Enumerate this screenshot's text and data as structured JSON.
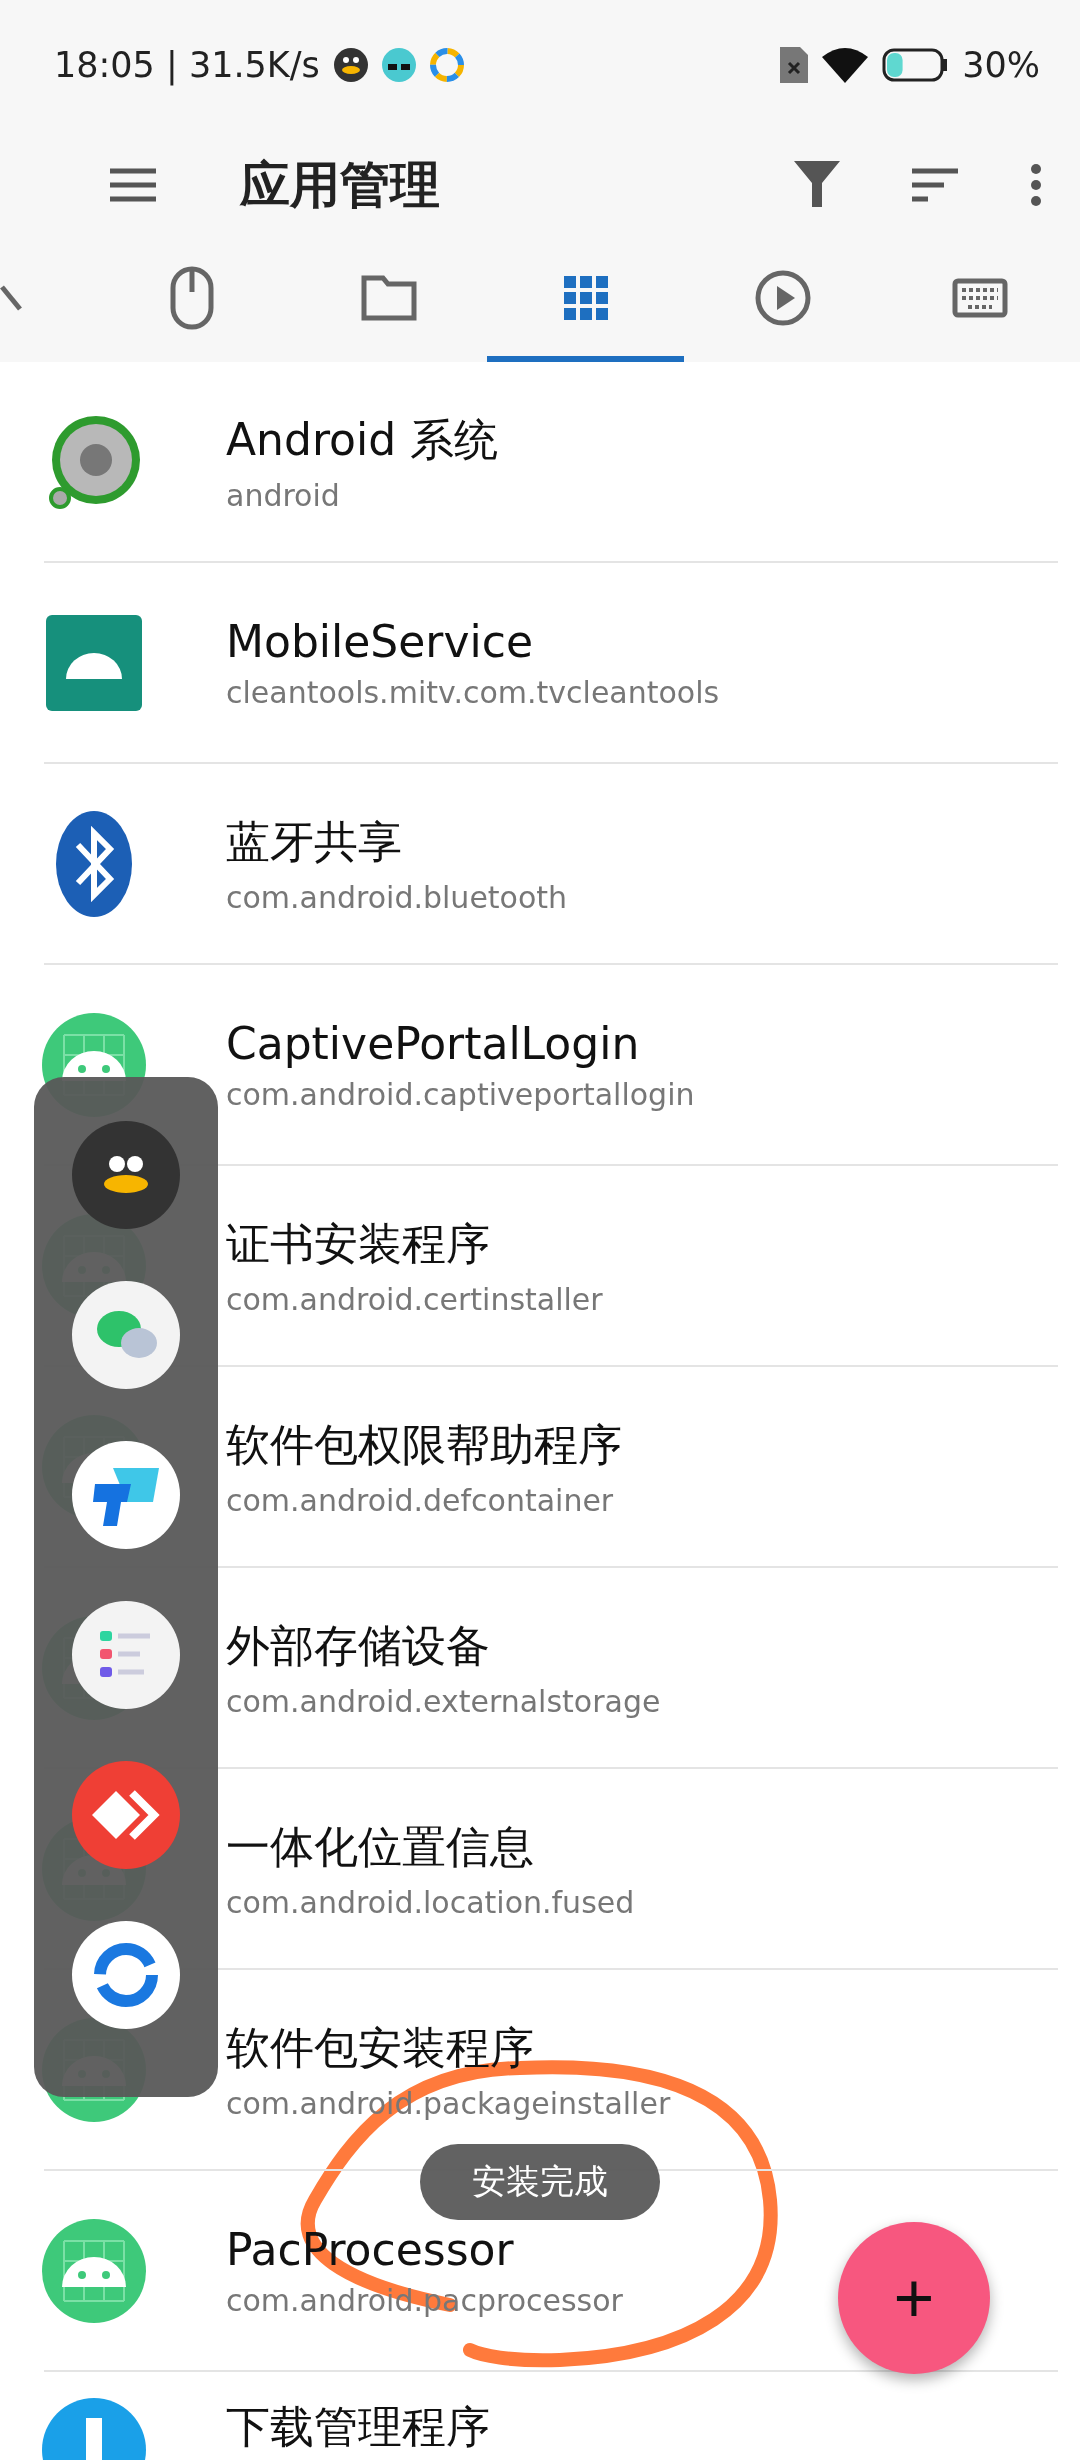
{
  "status_bar": {
    "time_speed": "18:05 | 31.5K/s",
    "notifications": [
      {
        "kind": "penguin"
      },
      {
        "kind": "magic"
      },
      {
        "kind": "swirl"
      }
    ],
    "battery": {
      "level": 0.3
    },
    "battery_text": "30%"
  },
  "toolbar": {
    "title": "应用管理"
  },
  "tabs": [
    {
      "kind": "pencil",
      "selected": false
    },
    {
      "kind": "mouse",
      "selected": false
    },
    {
      "kind": "folder",
      "selected": false
    },
    {
      "kind": "grid",
      "selected": true
    },
    {
      "kind": "play",
      "selected": false
    },
    {
      "kind": "keyboard",
      "selected": false
    }
  ],
  "apps": [
    {
      "kind": "system",
      "name": "Android 系统",
      "package": "android"
    },
    {
      "kind": "mobileservice",
      "name": "MobileService",
      "package": "cleantools.mitv.com.tvcleantools"
    },
    {
      "kind": "bluetooth",
      "name": "蓝牙共享",
      "package": "com.android.bluetooth"
    },
    {
      "kind": "android",
      "name": "CaptivePortalLogin",
      "package": "com.android.captiveportallogin"
    },
    {
      "kind": "android",
      "name": "证书安装程序",
      "package": "com.android.certinstaller"
    },
    {
      "kind": "android",
      "name": "软件包权限帮助程序",
      "package": "com.android.defcontainer"
    },
    {
      "kind": "android",
      "name": "外部存储设备",
      "package": "com.android.externalstorage"
    },
    {
      "kind": "android",
      "name": "一体化位置信息",
      "package": "com.android.location.fused"
    },
    {
      "kind": "android",
      "name": "软件包安装程序",
      "package": "com.android.packageinstaller"
    },
    {
      "kind": "android",
      "name": "PacProcessor",
      "package": "com.android.pacprocessor"
    },
    {
      "kind": "download",
      "name": "下载管理程序"
    }
  ],
  "floating_dock": [
    {
      "kind": "penguin"
    },
    {
      "kind": "chat"
    },
    {
      "kind": "tiles"
    },
    {
      "kind": "list"
    },
    {
      "kind": "arrows"
    },
    {
      "kind": "ring"
    }
  ],
  "toast": {
    "text": "安装完成"
  },
  "fab": {
    "label": "+"
  }
}
